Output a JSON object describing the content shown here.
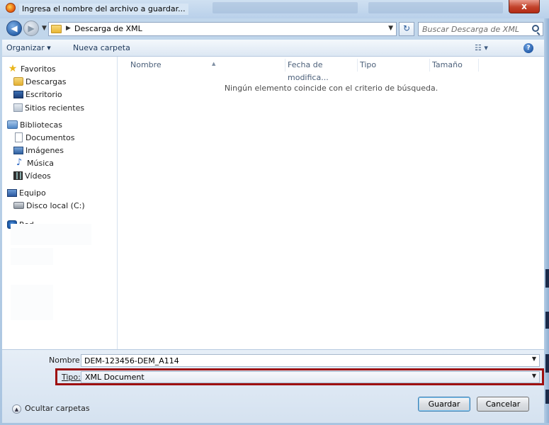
{
  "window": {
    "title": "Ingresa el nombre del archivo a guardar...",
    "close_label": "x"
  },
  "address": {
    "path": "Descarga de XML",
    "refresh_glyph": "↻",
    "search_placeholder": "Buscar Descarga de XML"
  },
  "toolbar": {
    "organize_label": "Organizar ▾",
    "new_folder_label": "Nueva carpeta",
    "views_glyph": "☷ ▾",
    "help_glyph": "?"
  },
  "sidebar": {
    "favorites": "Favoritos",
    "downloads": "Descargas",
    "desktop": "Escritorio",
    "recent": "Sitios recientes",
    "libraries": "Bibliotecas",
    "documents": "Documentos",
    "images": "Imágenes",
    "music": "Música",
    "videos": "Vídeos",
    "computer": "Equipo",
    "local_disk": "Disco local (C:)",
    "network": "Red"
  },
  "columns": {
    "name": "Nombre",
    "date": "Fecha de modifica...",
    "type": "Tipo",
    "size": "Tamaño"
  },
  "empty_message": "Ningún elemento coincide con el criterio de búsqueda.",
  "form": {
    "name_label": "Nombre:",
    "name_value": "DEM-123456-DEM_A114",
    "type_label": "Tipo:",
    "type_value": "XML Document"
  },
  "footer": {
    "hide_folders_label": "Ocultar carpetas",
    "save_label": "Guardar",
    "cancel_label": "Cancelar"
  },
  "colors": {
    "highlight_border": "#9e1010",
    "title_bar": "#c3d8ec",
    "close_button": "#c2432c"
  }
}
